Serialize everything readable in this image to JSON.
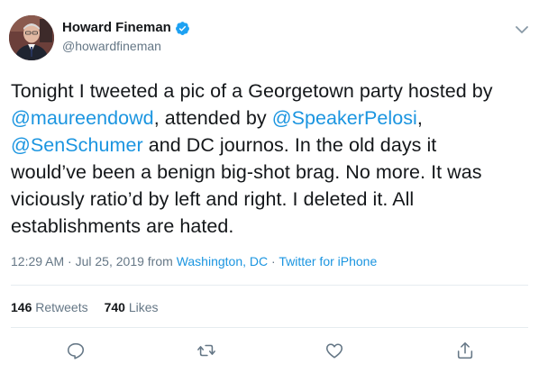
{
  "author": {
    "display_name": "Howard Fineman",
    "handle": "@howardfineman",
    "verified": true
  },
  "tweet": {
    "lines": [
      [
        {
          "t": "Tonight I tweeted a pic of a Georgetown party hosted by",
          "m": false
        }
      ],
      [
        {
          "t": "@maureendowd",
          "m": true
        },
        {
          "t": ", attended by ",
          "m": false
        },
        {
          "t": "@SpeakerPelosi",
          "m": true
        },
        {
          "t": ",",
          "m": false
        }
      ],
      [
        {
          "t": "@SenSchumer",
          "m": true
        },
        {
          "t": " and DC journos. In the old days it",
          "m": false
        }
      ],
      [
        {
          "t": "would’ve been a benign big-shot brag. No more. It was",
          "m": false
        }
      ],
      [
        {
          "t": "viciously ratio’d by left and right. I deleted it. All",
          "m": false
        }
      ],
      [
        {
          "t": "establishments are hated.",
          "m": false
        }
      ]
    ]
  },
  "meta": {
    "time": "12:29 AM",
    "sep1": " · ",
    "date": "Jul 25, 2019",
    "from": " from ",
    "location": "Washington, DC",
    "sep2": " · ",
    "source": "Twitter for iPhone"
  },
  "stats": {
    "retweets_count": "146",
    "retweets_label": "Retweets",
    "likes_count": "740",
    "likes_label": "Likes"
  },
  "actions": {
    "reply": "reply-icon",
    "retweet": "retweet-icon",
    "like": "heart-icon",
    "share": "share-icon"
  },
  "colors": {
    "accent": "#1b95e0",
    "text": "#14171a",
    "muted": "#657786",
    "divider": "#e6ecf0",
    "verified": "#1da1f2"
  }
}
